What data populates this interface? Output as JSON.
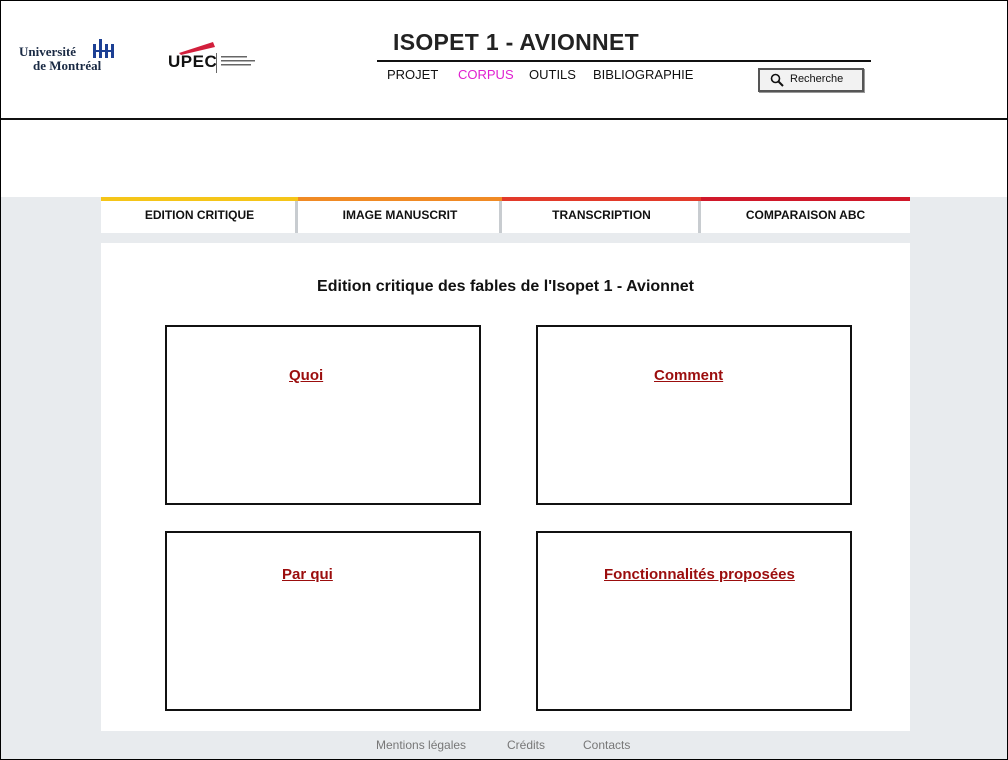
{
  "header": {
    "logos": {
      "udem_line1": "Université",
      "udem_line2": "de Montréal",
      "upec_text": "UPEC"
    },
    "site_title": "ISOPET 1 - AVIONNET",
    "nav": {
      "projet": "PROJET",
      "corpus": "CORPUS",
      "outils": "OUTILS",
      "bibliographie": "BIBLIOGRAPHIE"
    },
    "search_label": "Recherche",
    "active_nav_color": "#e020d0"
  },
  "tabs": [
    {
      "label": "EDITION CRITIQUE",
      "color": "#f5c518"
    },
    {
      "label": "IMAGE MANUSCRIT",
      "color": "#f08a24"
    },
    {
      "label": "TRANSCRIPTION",
      "color": "#e23a2a"
    },
    {
      "label": "COMPARAISON ABC",
      "color": "#d0182a"
    }
  ],
  "main": {
    "title": "Edition critique des fables de l'Isopet 1 - Avionnet",
    "cards": {
      "quoi": "Quoi",
      "comment": "Comment",
      "par_qui": "Par qui",
      "fonctionnalites": "Fonctionnalités proposées"
    },
    "link_color": "#9b0d0d"
  },
  "footer": {
    "mentions": "Mentions légales",
    "credits": "Crédits",
    "contacts": "Contacts"
  }
}
